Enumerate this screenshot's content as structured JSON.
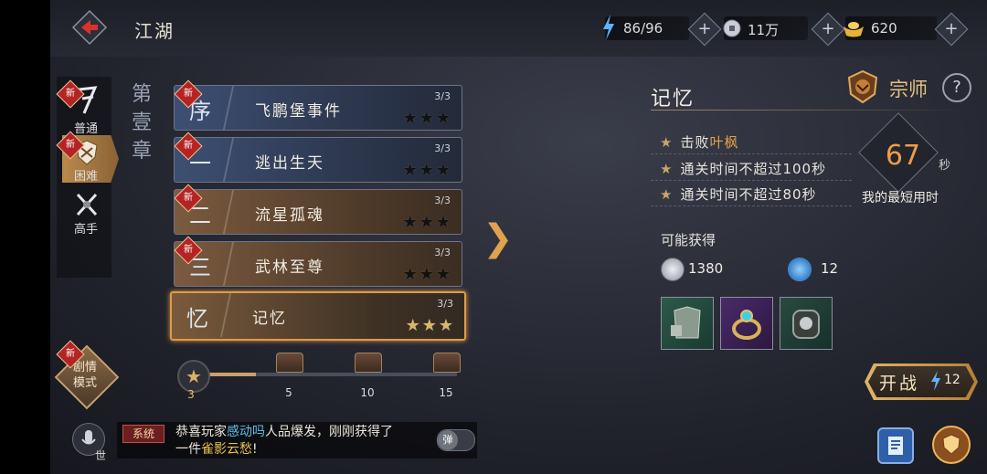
{
  "header": {
    "title": "江湖",
    "energy": "86/96",
    "silver": "11万",
    "gold": "620",
    "plus": "+"
  },
  "modes": [
    {
      "label": "普通",
      "new": "新"
    },
    {
      "label": "困难",
      "new": "新"
    },
    {
      "label": "高手"
    }
  ],
  "chapter": [
    "第",
    "壹",
    "章"
  ],
  "stages": [
    {
      "num": "序",
      "name": "飞鹏堡事件",
      "progress": "3/3",
      "stars": "★★★",
      "new": "新",
      "style": "blue"
    },
    {
      "num": "一",
      "name": "逃出生天",
      "progress": "3/3",
      "stars": "★★★",
      "new": "新",
      "style": "blue"
    },
    {
      "num": "二",
      "name": "流星孤魂",
      "progress": "3/3",
      "stars": "★★★",
      "new": "新",
      "style": "brown"
    },
    {
      "num": "三",
      "name": "武林至尊",
      "progress": "3/3",
      "stars": "★★★",
      "new": "新",
      "style": "brown"
    },
    {
      "num": "忆",
      "name": "记忆",
      "progress": "3/3",
      "stars": "★★★",
      "style": "sel"
    }
  ],
  "progress": {
    "star": "★",
    "current": "3",
    "fraction": 0.2,
    "milestones": [
      "5",
      "10",
      "15"
    ]
  },
  "story_mode": {
    "label_1": "剧情",
    "label_2": "模式",
    "new": "新"
  },
  "detail": {
    "title": "记忆",
    "rank": "宗师",
    "help": "?",
    "objectives": {
      "o1_prefix": "击败",
      "o1_hl": "叶枫",
      "o2": "通关时间不超过100秒",
      "o3": "通关时间不超过80秒"
    },
    "best_time": "67",
    "time_unit": "秒",
    "best_time_label": "我的最短用时",
    "rewards_title": "可能获得",
    "reward_silver": "1380",
    "reward_energy": "12",
    "fight_label": "开战",
    "fight_cost": "12"
  },
  "chat": {
    "world": "世",
    "tag": "系统",
    "line1_pre": "恭喜玩家",
    "line1_name": "感动吗",
    "line1_post": "人品爆发，刚刚获得了",
    "line2_pre": "一件",
    "line2_item": "雀影云愁",
    "line2_post": "!",
    "toggle": "弹"
  },
  "colors": {
    "accent": "#e09a48",
    "highlight": "#e3a24a",
    "new_badge": "#b52424"
  }
}
